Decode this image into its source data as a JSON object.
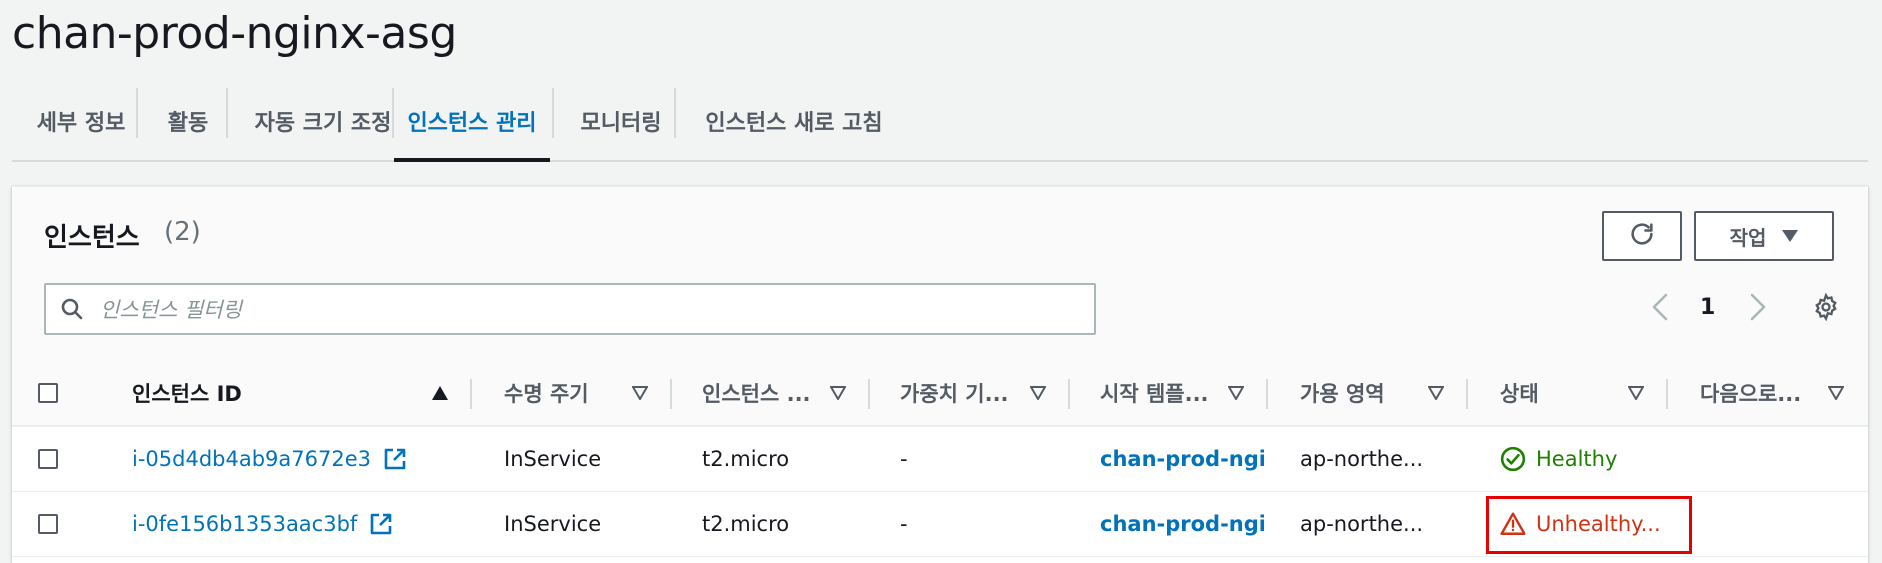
{
  "page": {
    "title": "chan-prod-nginx-asg"
  },
  "tabs": [
    {
      "label": "세부 정보"
    },
    {
      "label": "활동"
    },
    {
      "label": "자동 크기 조정"
    },
    {
      "label": "인스턴스 관리"
    },
    {
      "label": "모니터링"
    },
    {
      "label": "인스턴스 새로 고침"
    }
  ],
  "active_tab": "인스턴스 관리",
  "panel": {
    "title": "인스턴스",
    "count": "(2)",
    "actions_label": "작업",
    "search_placeholder": "인스턴스 필터링",
    "page_number": "1"
  },
  "columns": [
    {
      "label": "인스턴스 ID",
      "sort": "ascending"
    },
    {
      "label": "수명 주기",
      "sort": "none"
    },
    {
      "label": "인스턴스 ...",
      "sort": "none"
    },
    {
      "label": "가중치 기...",
      "sort": "none"
    },
    {
      "label": "시작 템플...",
      "sort": "none"
    },
    {
      "label": "가용 영역",
      "sort": "none"
    },
    {
      "label": "상태",
      "sort": "none"
    },
    {
      "label": "다음으로...",
      "sort": "none"
    }
  ],
  "rows": [
    {
      "instance_id": "i-05d4db4ab9a7672e3",
      "lifecycle": "InService",
      "instance_type": "t2.micro",
      "weight": "-",
      "launch_template": "chan-prod-ngin",
      "availability_zone": "ap-northe...",
      "status": "Healthy",
      "status_kind": "healthy"
    },
    {
      "instance_id": "i-0fe156b1353aac3bf",
      "lifecycle": "InService",
      "instance_type": "t2.micro",
      "weight": "-",
      "launch_template": "chan-prod-ngin",
      "availability_zone": "ap-northe...",
      "status": "Unhealthy...",
      "status_kind": "unhealthy"
    }
  ],
  "colors": {
    "link": "#0073bb",
    "healthy": "#1d8102",
    "unhealthy": "#d13212",
    "highlight_box": "#e60000"
  },
  "icons": {
    "refresh": "refresh-icon",
    "actions_caret": "caret-down-icon",
    "search": "search-icon",
    "prev": "chevron-left-icon",
    "next": "chevron-right-icon",
    "settings": "gear-icon",
    "external": "external-link-icon",
    "healthy": "check-circle-icon",
    "unhealthy": "warning-icon"
  }
}
